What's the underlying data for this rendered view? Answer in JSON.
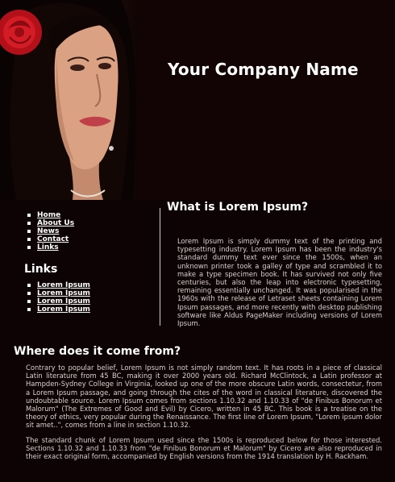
{
  "header": {
    "company_name": "Your Company Name"
  },
  "nav": {
    "items": [
      {
        "label": "Home"
      },
      {
        "label": "About Us"
      },
      {
        "label": "News"
      },
      {
        "label": "Contact"
      },
      {
        "label": "Links"
      }
    ]
  },
  "links_section": {
    "heading": "Links",
    "items": [
      {
        "label": "Lorem Ipsum"
      },
      {
        "label": "Lorem Ipsum"
      },
      {
        "label": "Lorem Ipsum"
      },
      {
        "label": "Lorem Ipsum"
      }
    ]
  },
  "what": {
    "heading": "What is Lorem Ipsum?",
    "text": "Lorem Ipsum is simply dummy text of the printing and typesetting industry. Lorem Ipsum has been the industry's standard dummy text ever since the 1500s, when an unknown printer took a galley of type and scrambled it to make a type specimen book. It has survived not only five centuries, but also the leap into electronic typesetting, remaining essentially unchanged. It was popularised in the 1960s with the release of Letraset sheets containing Lorem Ipsum passages, and more recently with desktop publishing software like Aldus PageMaker including versions of Lorem Ipsum."
  },
  "where": {
    "heading": "Where does it come from?",
    "paragraph1": "Contrary to popular belief, Lorem Ipsum is not simply random text. It has roots in a piece of classical Latin literature from 45 BC, making it over 2000 years old. Richard McClintock, a Latin professor at Hampden-Sydney College in Virginia, looked up one of the more obscure Latin words, consectetur, from a Lorem Ipsum passage, and going through the cites of the word in classical literature, discovered the undoubtable source. Lorem Ipsum comes from sections 1.10.32 and 1.10.33 of \"de Finibus Bonorum et Malorum\" (The Extremes of Good and Evil) by Cicero, written in 45 BC. This book is a treatise on the theory of ethics, very popular during the Renaissance. The first line of Lorem Ipsum, \"Lorem ipsum dolor sit amet..\", comes from a line in section 1.10.32.",
    "paragraph2": "The standard chunk of Lorem Ipsum used since the 1500s is reproduced below for those interested. Sections 1.10.32 and 1.10.33 from \"de Finibus Bonorum et Malorum\" by Cicero are also reproduced in their exact original form, accompanied by English versions from the 1914 translation by H. Rackham."
  },
  "colors": {
    "background": "#0d0304",
    "header_bg": "#120405",
    "text": "#dcd0d0",
    "heading": "#ffffff",
    "accent_rose": "#c8141e"
  }
}
